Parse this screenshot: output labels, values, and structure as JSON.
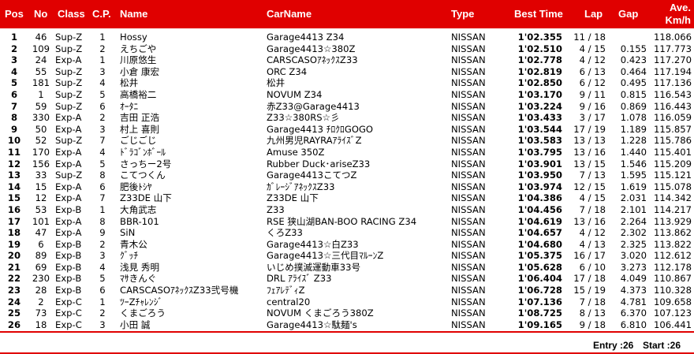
{
  "header": {
    "pos": "Pos",
    "no": "No",
    "class": "Class",
    "cp": "C.P.",
    "name": "Name",
    "car": "CarName",
    "type": "Type",
    "best": "Best Time",
    "lap": "Lap",
    "gap": "Gap",
    "avg_line1": "Ave.",
    "avg_line2": "Km/h"
  },
  "rows": [
    {
      "pos": "1",
      "no": "46",
      "cls": "Sup-Z",
      "cp": "1",
      "name": "Hossy",
      "car": "Garage4413 Z34",
      "type": "NISSAN",
      "best": "1'02.355",
      "lap": "11 / 18",
      "gap": "",
      "avg": "118.066"
    },
    {
      "pos": "2",
      "no": "109",
      "cls": "Sup-Z",
      "cp": "2",
      "name": "えちごや",
      "car": "Garage4413☆380Z",
      "type": "NISSAN",
      "best": "1'02.510",
      "lap": "4 / 15",
      "gap": "0.155",
      "avg": "117.773"
    },
    {
      "pos": "3",
      "no": "24",
      "cls": "Exp-A",
      "cp": "1",
      "name": "川原悠生",
      "car": "CARSCASOｱﾈｯｸｽZ33",
      "type": "NISSAN",
      "best": "1'02.778",
      "lap": "4 / 12",
      "gap": "0.423",
      "avg": "117.270"
    },
    {
      "pos": "4",
      "no": "55",
      "cls": "Sup-Z",
      "cp": "3",
      "name": "小倉 康宏",
      "car": "ORC Z34",
      "type": "NISSAN",
      "best": "1'02.819",
      "lap": "6 / 13",
      "gap": "0.464",
      "avg": "117.194"
    },
    {
      "pos": "5",
      "no": "181",
      "cls": "Sup-Z",
      "cp": "4",
      "name": "松井",
      "car": "松井",
      "type": "NISSAN",
      "best": "1'02.850",
      "lap": "6 / 12",
      "gap": "0.495",
      "avg": "117.136"
    },
    {
      "pos": "6",
      "no": "1",
      "cls": "Sup-Z",
      "cp": "5",
      "name": "高橋裕二",
      "car": "NOVUM Z34",
      "type": "NISSAN",
      "best": "1'03.170",
      "lap": "9 / 11",
      "gap": "0.815",
      "avg": "116.543"
    },
    {
      "pos": "7",
      "no": "59",
      "cls": "Sup-Z",
      "cp": "6",
      "name": "ｵｰﾀﾆ",
      "car": "赤Z33@Garage4413",
      "type": "NISSAN",
      "best": "1'03.224",
      "lap": "9 / 16",
      "gap": "0.869",
      "avg": "116.443"
    },
    {
      "pos": "8",
      "no": "330",
      "cls": "Exp-A",
      "cp": "2",
      "name": "吉田 正浩",
      "car": "Z33☆380RS☆彡",
      "type": "NISSAN",
      "best": "1'03.433",
      "lap": "3 / 17",
      "gap": "1.078",
      "avg": "116.059"
    },
    {
      "pos": "9",
      "no": "50",
      "cls": "Exp-A",
      "cp": "3",
      "name": "村上 喜則",
      "car": "Garage4413 ﾁﾛｸﾛGOGO",
      "type": "NISSAN",
      "best": "1'03.544",
      "lap": "17 / 19",
      "gap": "1.189",
      "avg": "115.857"
    },
    {
      "pos": "10",
      "no": "52",
      "cls": "Sup-Z",
      "cp": "7",
      "name": "ごじごじ",
      "car": "九州男児RAYRAｱﾗｲｽﾞZ",
      "type": "NISSAN",
      "best": "1'03.583",
      "lap": "13 / 13",
      "gap": "1.228",
      "avg": "115.786"
    },
    {
      "pos": "11",
      "no": "170",
      "cls": "Exp-A",
      "cp": "4",
      "name": "ﾄﾞﾗｺﾞﾝﾎﾞｰﾙ",
      "car": "Amuse 350Z",
      "type": "NISSAN",
      "best": "1'03.795",
      "lap": "13 / 16",
      "gap": "1.440",
      "avg": "115.401"
    },
    {
      "pos": "12",
      "no": "156",
      "cls": "Exp-A",
      "cp": "5",
      "name": "さっちー2号",
      "car": "Rubber Duck･ariseZ33",
      "type": "NISSAN",
      "best": "1'03.901",
      "lap": "13 / 15",
      "gap": "1.546",
      "avg": "115.209"
    },
    {
      "pos": "13",
      "no": "33",
      "cls": "Sup-Z",
      "cp": "8",
      "name": "こてつくん",
      "car": "Garage4413こてつZ",
      "type": "NISSAN",
      "best": "1'03.950",
      "lap": "7 / 13",
      "gap": "1.595",
      "avg": "115.121"
    },
    {
      "pos": "14",
      "no": "15",
      "cls": "Exp-A",
      "cp": "6",
      "name": "肥後ﾄｼﾔ",
      "car": "ｶﾞﾚｰｼﾞｱﾈｯｸｽZ33",
      "type": "NISSAN",
      "best": "1'03.974",
      "lap": "12 / 15",
      "gap": "1.619",
      "avg": "115.078"
    },
    {
      "pos": "15",
      "no": "12",
      "cls": "Exp-A",
      "cp": "7",
      "name": "Z33DE 山下",
      "car": "Z33DE 山下",
      "type": "NISSAN",
      "best": "1'04.386",
      "lap": "4 / 15",
      "gap": "2.031",
      "avg": "114.342"
    },
    {
      "pos": "16",
      "no": "53",
      "cls": "Exp-B",
      "cp": "1",
      "name": "大角武志",
      "car": "Z33",
      "type": "NISSAN",
      "best": "1'04.456",
      "lap": "7 / 18",
      "gap": "2.101",
      "avg": "114.217"
    },
    {
      "pos": "17",
      "no": "101",
      "cls": "Exp-A",
      "cp": "8",
      "name": "BBR-101",
      "car": "RSE 狭山湖BAN-BOO RACING Z34",
      "type": "NISSAN",
      "best": "1'04.619",
      "lap": "13 / 16",
      "gap": "2.264",
      "avg": "113.929"
    },
    {
      "pos": "18",
      "no": "47",
      "cls": "Exp-A",
      "cp": "9",
      "name": "SiN",
      "car": "くろZ33",
      "type": "NISSAN",
      "best": "1'04.657",
      "lap": "4 / 12",
      "gap": "2.302",
      "avg": "113.862"
    },
    {
      "pos": "19",
      "no": "6",
      "cls": "Exp-B",
      "cp": "2",
      "name": "青木公",
      "car": "Garage4413☆白Z33",
      "type": "NISSAN",
      "best": "1'04.680",
      "lap": "4 / 13",
      "gap": "2.325",
      "avg": "113.822"
    },
    {
      "pos": "20",
      "no": "89",
      "cls": "Exp-B",
      "cp": "3",
      "name": "ｸﾞｯﾁ",
      "car": "Garage4413☆三代目ﾏﾙｰﾝZ",
      "type": "NISSAN",
      "best": "1'05.375",
      "lap": "16 / 17",
      "gap": "3.020",
      "avg": "112.612"
    },
    {
      "pos": "21",
      "no": "69",
      "cls": "Exp-B",
      "cp": "4",
      "name": "浅見 秀明",
      "car": "いじめ撲滅運動車33号",
      "type": "NISSAN",
      "best": "1'05.628",
      "lap": "6 / 10",
      "gap": "3.273",
      "avg": "112.178"
    },
    {
      "pos": "22",
      "no": "230",
      "cls": "Exp-B",
      "cp": "5",
      "name": "ﾏｻきんぐ",
      "car": "DRL ｱﾗｲｽﾞ Z33",
      "type": "NISSAN",
      "best": "1'06.404",
      "lap": "17 / 18",
      "gap": "4.049",
      "avg": "110.867"
    },
    {
      "pos": "23",
      "no": "28",
      "cls": "Exp-B",
      "cp": "6",
      "name": "CARSCASOｱﾈｯｸｽZ33弐号機",
      "car": "ﾌｪｱﾚﾃﾞｨZ",
      "type": "NISSAN",
      "best": "1'06.728",
      "lap": "15 / 19",
      "gap": "4.373",
      "avg": "110.328"
    },
    {
      "pos": "24",
      "no": "2",
      "cls": "Exp-C",
      "cp": "1",
      "name": "ﾂｰZﾁｬﾚﾝｼﾞ",
      "car": "central20",
      "type": "NISSAN",
      "best": "1'07.136",
      "lap": "7 / 18",
      "gap": "4.781",
      "avg": "109.658"
    },
    {
      "pos": "25",
      "no": "73",
      "cls": "Exp-C",
      "cp": "2",
      "name": "くまごろう",
      "car": "NOVUM くまごろう380Z",
      "type": "NISSAN",
      "best": "1'08.725",
      "lap": "8 / 13",
      "gap": "6.370",
      "avg": "107.123"
    },
    {
      "pos": "26",
      "no": "18",
      "cls": "Exp-C",
      "cp": "3",
      "name": "小田 誠",
      "car": "Garage4413☆駄麺's",
      "type": "NISSAN",
      "best": "1'09.165",
      "lap": "9 / 18",
      "gap": "6.810",
      "avg": "106.441"
    }
  ],
  "footer": {
    "entry": "Entry :26",
    "start": "Start :26"
  },
  "colors": {
    "accent": "#e00000",
    "header_text": "#ffffff"
  }
}
